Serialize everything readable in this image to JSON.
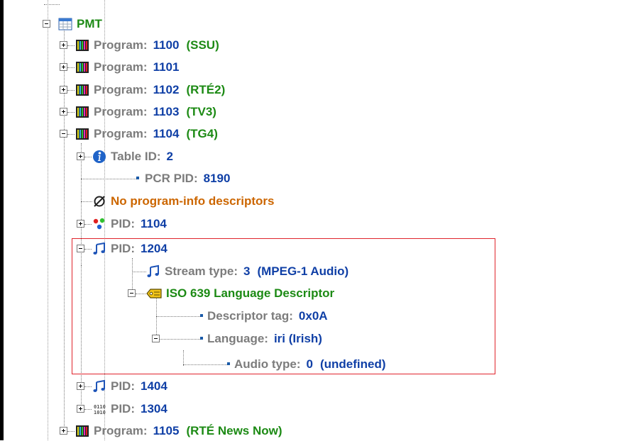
{
  "tree": {
    "pmt": {
      "label": "PMT"
    },
    "programs": [
      {
        "label": "Program:",
        "value": "1100",
        "extra": "(SSU)"
      },
      {
        "label": "Program:",
        "value": "1101",
        "extra": ""
      },
      {
        "label": "Program:",
        "value": "1102",
        "extra": "(RTÉ2)"
      },
      {
        "label": "Program:",
        "value": "1103",
        "extra": "(TV3)"
      },
      {
        "label": "Program:",
        "value": "1104",
        "extra": "(TG4)"
      }
    ],
    "program_1104": {
      "table_id": {
        "label": "Table ID:",
        "value": "2"
      },
      "pcr_pid": {
        "label": "PCR PID:",
        "value": "8190"
      },
      "no_descriptors": "No program-info descriptors",
      "pid_1104": {
        "label": "PID:",
        "value": "1104"
      },
      "pid_1204": {
        "label": "PID:",
        "value": "1204",
        "stream_type": {
          "label": "Stream type:",
          "value": "3",
          "extra": "(MPEG-1 Audio)"
        },
        "iso639": {
          "label": "ISO 639 Language Descriptor",
          "descriptor_tag": {
            "label": "Descriptor tag:",
            "value": "0x0A"
          },
          "language": {
            "label": "Language:",
            "value": "iri (Irish)",
            "audio_type": {
              "label": "Audio type:",
              "value": "0",
              "extra": "(undefined)"
            }
          }
        }
      },
      "pid_1404": {
        "label": "PID:",
        "value": "1404"
      },
      "pid_1304": {
        "label": "PID:",
        "value": "1304"
      }
    },
    "program_1105": {
      "label": "Program:",
      "value": "1105",
      "extra": "(RTÉ News Now)"
    }
  },
  "colors": {
    "label": "#7c7c7c",
    "value": "#0f3fa6",
    "program_name": "#1c8a14",
    "warning": "#cc6600",
    "highlight_border": "#e0242c"
  },
  "icons": {
    "pmt": "table-icon",
    "program": "program-bars-icon",
    "table_id": "info-icon",
    "no_descriptors": "empty-set-icon",
    "pid_video": "color-dots-icon",
    "pid_audio": "music-note-icon",
    "descriptor": "tag-icon",
    "pid_data": "binary-icon"
  }
}
